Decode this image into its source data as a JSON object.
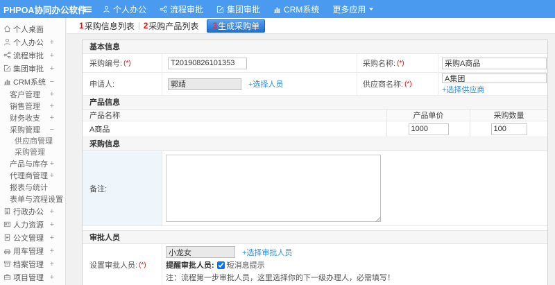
{
  "topbar": {
    "logo": "PHPOA协同办公软件",
    "menus": [
      {
        "name": "personal-office",
        "icon": "user-icon",
        "label": "个人办公"
      },
      {
        "name": "workflow-approval",
        "icon": "flow-icon",
        "label": "流程审批"
      },
      {
        "name": "group-approval",
        "icon": "edit-icon",
        "label": "集团审批"
      },
      {
        "name": "crm-system",
        "icon": "chart-icon",
        "label": "CRM系统"
      },
      {
        "name": "more-apps",
        "icon": "",
        "label": "更多应用",
        "caret": true
      }
    ]
  },
  "sidebar": {
    "items": [
      {
        "name": "personal-desktop",
        "icon": "home-icon",
        "label": "个人桌面",
        "level": 1,
        "expand": ""
      },
      {
        "name": "personal-office",
        "icon": "user-icon",
        "label": "个人办公",
        "level": 1,
        "expand": "+"
      },
      {
        "name": "workflow-approval",
        "icon": "flow-icon",
        "label": "流程审批",
        "level": 1,
        "expand": "+"
      },
      {
        "name": "group-approval",
        "icon": "edit-icon",
        "label": "集团审批",
        "level": 1,
        "expand": "+"
      },
      {
        "name": "crm-system",
        "icon": "chart-icon",
        "label": "CRM系统",
        "level": 1,
        "expand": "−"
      },
      {
        "name": "customer-management",
        "icon": "",
        "label": "客户管理",
        "level": 2,
        "expand": "+"
      },
      {
        "name": "sales-management",
        "icon": "",
        "label": "销售管理",
        "level": 2,
        "expand": "+"
      },
      {
        "name": "finance-income-expense",
        "icon": "",
        "label": "财务收支",
        "level": 2,
        "expand": "+"
      },
      {
        "name": "purchase-management",
        "icon": "",
        "label": "采购管理",
        "level": 2,
        "expand": "−"
      },
      {
        "name": "supplier-management",
        "icon": "",
        "label": "供应商管理",
        "level": 3,
        "expand": ""
      },
      {
        "name": "purchase-management-sub",
        "icon": "",
        "label": "采购管理",
        "level": 3,
        "expand": ""
      },
      {
        "name": "product-inventory",
        "icon": "",
        "label": "产品与库存",
        "level": 2,
        "expand": "+"
      },
      {
        "name": "agent-management",
        "icon": "",
        "label": "代理商管理",
        "level": 2,
        "expand": "+"
      },
      {
        "name": "reports-statistics",
        "icon": "",
        "label": "报表与统计",
        "level": 2,
        "expand": ""
      },
      {
        "name": "form-workflow-settings",
        "icon": "",
        "label": "表单与流程设置",
        "level": 2,
        "expand": "+"
      },
      {
        "name": "admin-office",
        "icon": "building-icon",
        "label": "行政办公",
        "level": 1,
        "expand": "+"
      },
      {
        "name": "human-resources",
        "icon": "idcard-icon",
        "label": "人力资源",
        "level": 1,
        "expand": "+"
      },
      {
        "name": "official-documents",
        "icon": "document-icon",
        "label": "公文管理",
        "level": 1,
        "expand": "+"
      },
      {
        "name": "vehicle-management",
        "icon": "car-icon",
        "label": "用车管理",
        "level": 1,
        "expand": "+"
      },
      {
        "name": "archive-management",
        "icon": "archive-icon",
        "label": "档案管理",
        "level": 1,
        "expand": "+"
      },
      {
        "name": "project-management",
        "icon": "project-icon",
        "label": "项目管理",
        "level": 1,
        "expand": "+"
      }
    ]
  },
  "steps": [
    {
      "num": "1",
      "label": "采购信息列表"
    },
    {
      "num": "2",
      "label": "采购产品列表"
    },
    {
      "num": "3",
      "label": "生成采购单"
    }
  ],
  "form": {
    "basic": {
      "title": "基本信息",
      "purchase_no": {
        "label": "采购编号:",
        "required": "(*)",
        "value": "T20190826101353"
      },
      "purchase_name": {
        "label": "采购名称:",
        "required": "(*)",
        "value": "采购A商品"
      },
      "applicant": {
        "label": "申请人:",
        "value": "郭靖",
        "link": "+选择人员"
      },
      "supplier": {
        "label": "供应商名称:",
        "required": "(*)",
        "value": "A集团",
        "link": "+选择供应商"
      }
    },
    "products": {
      "title": "产品信息",
      "columns": [
        "产品名称",
        "产品单价",
        "采购数量"
      ],
      "rows": [
        {
          "name": "A商品",
          "price": "1000",
          "qty": "100"
        }
      ]
    },
    "purchase_info": {
      "title": "采购信息",
      "note_label": "备注:",
      "note_value": ""
    },
    "approval": {
      "title": "审批人员",
      "label": "设置审批人员:",
      "required": "(*)",
      "approver": "小龙女",
      "link": "+选择审批人员",
      "remind_label": "提醒审批人员:",
      "checkbox_label": "短消息提示",
      "checkbox_checked": true,
      "note": "注：流程第一步审批人员，这里选择你的下一级办理人，必需填写！"
    }
  },
  "colors": {
    "topbar": "#4a9bf0",
    "link": "#2f8ee3",
    "required": "#ff0000"
  }
}
